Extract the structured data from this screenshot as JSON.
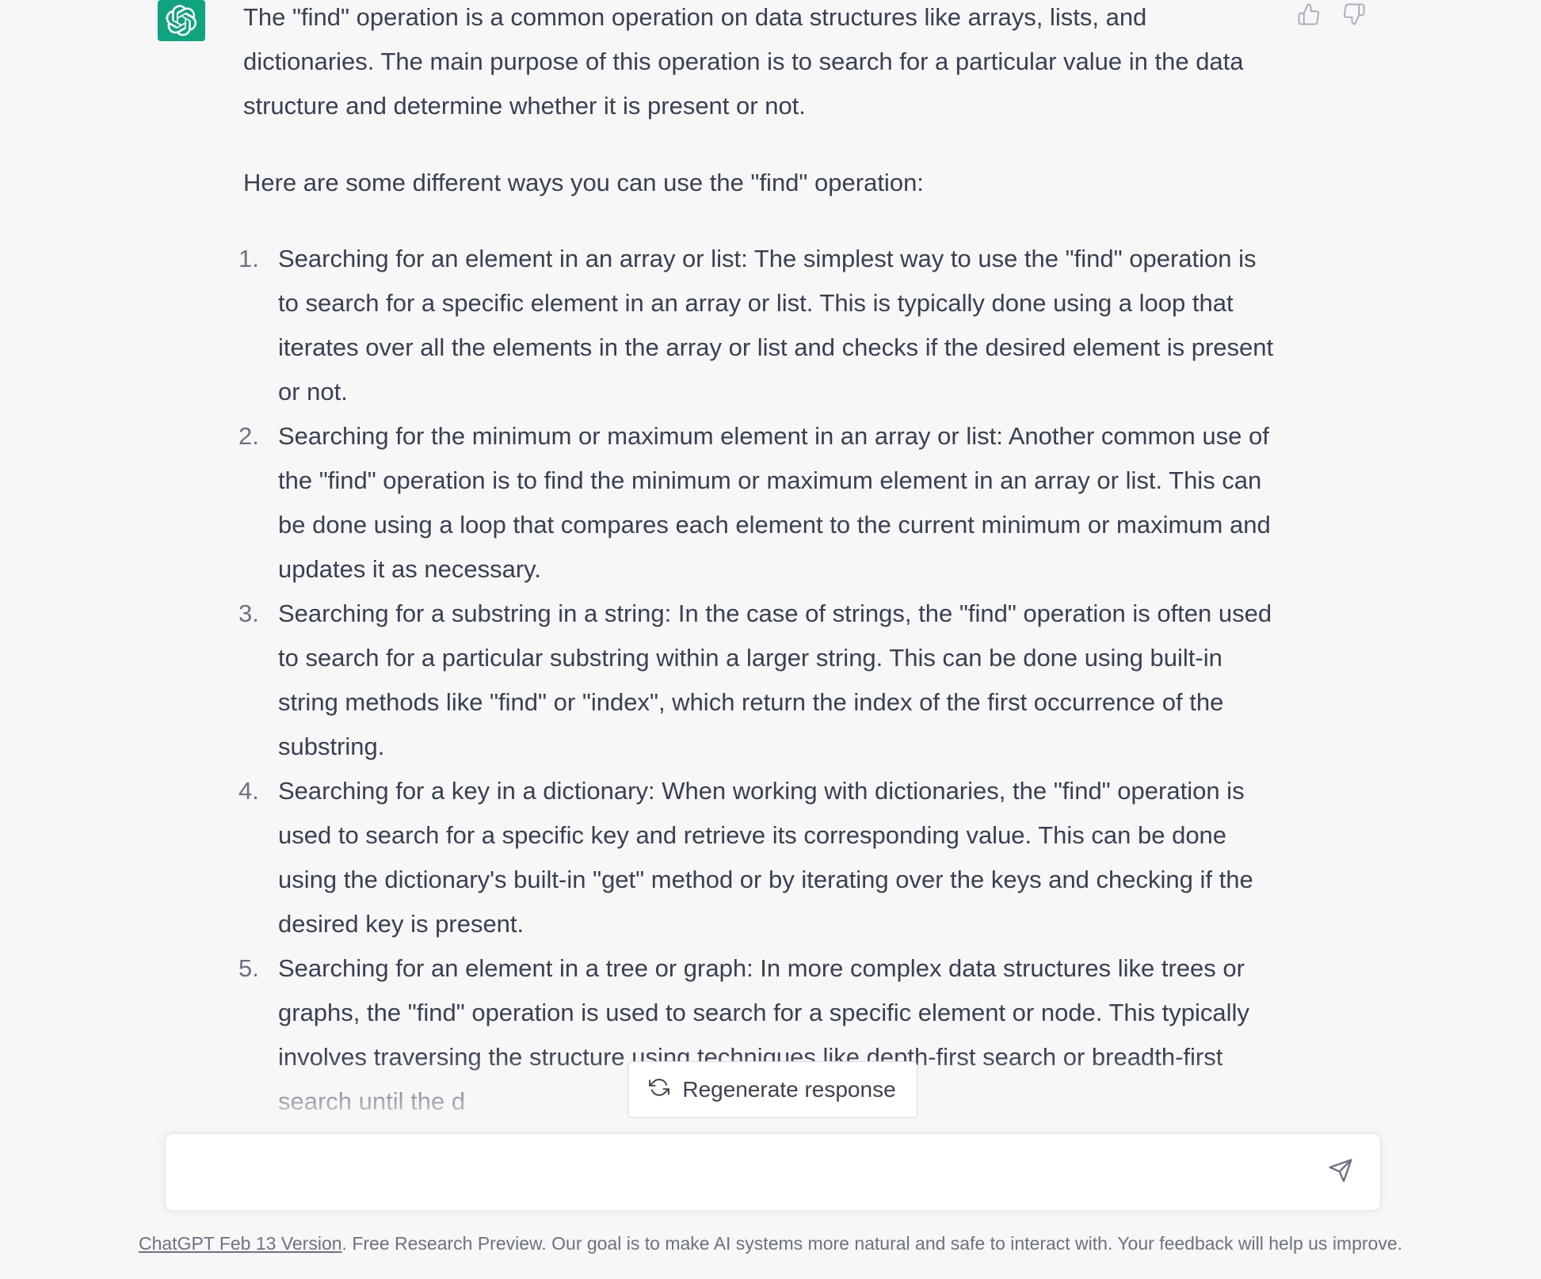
{
  "message": {
    "intro": "The \"find\" operation is a common operation on data structures like arrays, lists, and dictionaries. The main purpose of this operation is to search for a particular value in the data structure and determine whether it is present or not.",
    "lead": "Here are some different ways you can use the \"find\" operation:",
    "items": [
      {
        "number": "1.",
        "text": "Searching for an element in an array or list: The simplest way to use the \"find\" operation is to search for a specific element in an array or list. This is typically done using a loop that iterates over all the elements in the array or list and checks if the desired element is present or not."
      },
      {
        "number": "2.",
        "text": "Searching for the minimum or maximum element in an array or list: Another common use of the \"find\" operation is to find the minimum or maximum element in an array or list. This can be done using a loop that compares each element to the current minimum or maximum and updates it as necessary."
      },
      {
        "number": "3.",
        "text": "Searching for a substring in a string: In the case of strings, the \"find\" operation is often used to search for a particular substring within a larger string. This can be done using built-in string methods like \"find\" or \"index\", which return the index of the first occurrence of the substring."
      },
      {
        "number": "4.",
        "text": "Searching for a key in a dictionary: When working with dictionaries, the \"find\" operation is used to search for a specific key and retrieve its corresponding value. This can be done using the dictionary's built-in \"get\" method or by iterating over the keys and checking if the desired key is present."
      },
      {
        "number": "5.",
        "text": "Searching for an element in a tree or graph: In more complex data structures like trees or graphs, the \"find\" operation is used to search for a specific element or node. This typically involves traversing the structure using techniques like depth-first search or breadth-first search until the d"
      }
    ],
    "avatar_icon": "openai-logo-icon",
    "feedback": {
      "thumbs_up_icon": "thumbs-up-icon",
      "thumbs_down_icon": "thumbs-down-icon"
    }
  },
  "regenerate": {
    "label": "Regenerate response",
    "icon": "refresh-icon"
  },
  "input": {
    "value": "",
    "placeholder": "",
    "send_icon": "send-icon"
  },
  "footer": {
    "link_text": "ChatGPT Feb 13 Version",
    "text": ". Free Research Preview. Our goal is to make AI systems more natural and safe to interact with. Your feedback will help us improve."
  },
  "colors": {
    "background": "#f7f7f8",
    "text": "#374151",
    "avatar": "#10a37f",
    "muted": "#6b7280"
  }
}
